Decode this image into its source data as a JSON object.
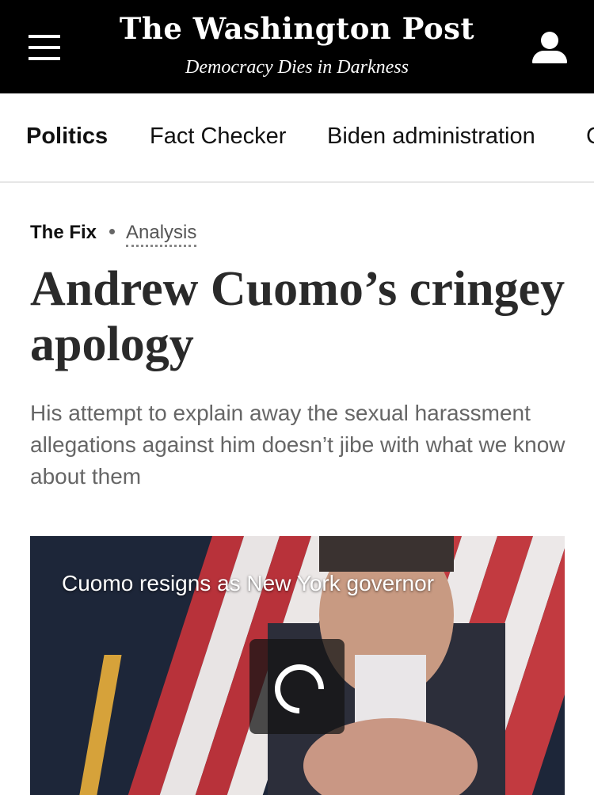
{
  "header": {
    "logo": "The Washington Post",
    "tagline": "Democracy Dies in Darkness",
    "menu_icon": "hamburger-menu-icon",
    "account_icon": "user-icon",
    "background": "#000000"
  },
  "nav": {
    "items": [
      {
        "label": "Politics",
        "active": true
      },
      {
        "label": "Fact Checker",
        "active": false
      },
      {
        "label": "Biden administration",
        "active": false
      },
      {
        "label": "C",
        "active": false
      }
    ]
  },
  "article": {
    "section": "The Fix",
    "label": "Analysis",
    "headline": "Andrew Cuomo’s cringey apology",
    "dek": "His attempt to explain away the sexual harassment allegations against him doesn’t jibe with what we know about them"
  },
  "video": {
    "title": "Cuomo resigns as New York governor",
    "loading_icon": "loading-spinner-icon"
  }
}
